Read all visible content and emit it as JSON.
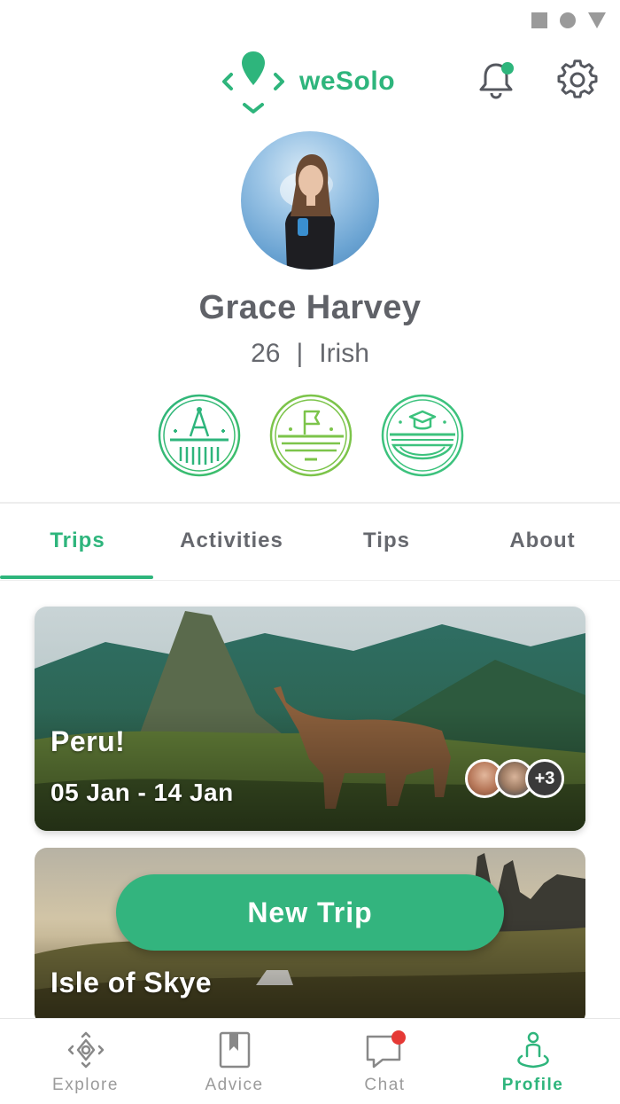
{
  "status_bar": {
    "icons": [
      "square-icon",
      "circle-icon",
      "triangle-icon"
    ]
  },
  "app": {
    "brand": "weSolo",
    "accent": "#2eb57c",
    "notification_dot": "#2eb57c"
  },
  "profile": {
    "name": "Grace Harvey",
    "age": "26",
    "separator": "|",
    "nationality": "Irish",
    "badges": [
      "compass-badge-icon",
      "flag-badge-icon",
      "graduation-badge-icon"
    ]
  },
  "tabs": [
    {
      "label": "Trips",
      "active": true
    },
    {
      "label": "Activities",
      "active": false
    },
    {
      "label": "Tips",
      "active": false
    },
    {
      "label": "About",
      "active": false
    }
  ],
  "trips": [
    {
      "title": "Peru!",
      "dates": "05 Jan - 14 Jan",
      "more_participants": "+3"
    },
    {
      "title": "Isle of Skye"
    }
  ],
  "fab": {
    "label": "New Trip"
  },
  "bottom_nav": [
    {
      "label": "Explore",
      "icon": "explore-icon",
      "active": false
    },
    {
      "label": "Advice",
      "icon": "book-icon",
      "active": false
    },
    {
      "label": "Chat",
      "icon": "chat-icon",
      "active": false,
      "badge_color": "#e53935"
    },
    {
      "label": "Profile",
      "icon": "profile-icon",
      "active": true
    }
  ]
}
